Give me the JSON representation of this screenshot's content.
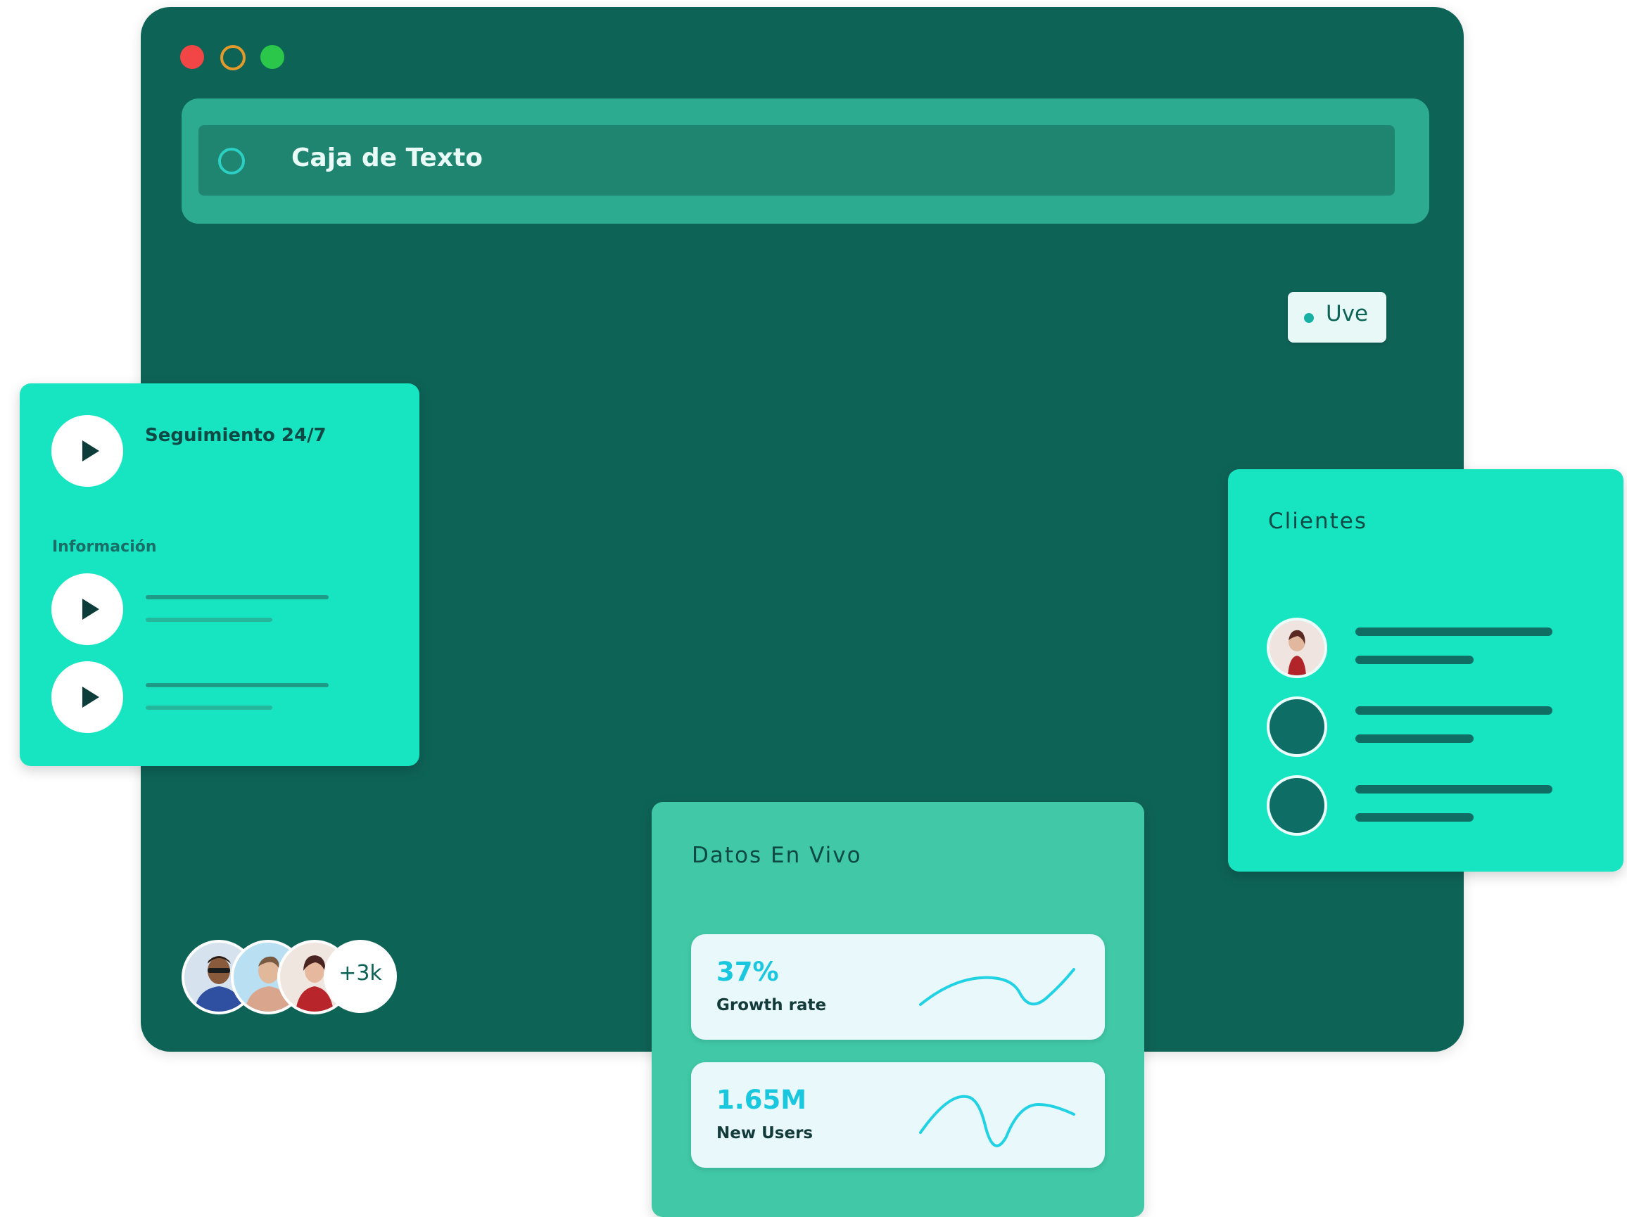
{
  "window": {
    "controls": [
      "close",
      "minimize",
      "maximize"
    ]
  },
  "search": {
    "placeholder": "Caja de Texto",
    "icon": "search-icon"
  },
  "live_badge": {
    "label": "Uve"
  },
  "tracking_card": {
    "title": "Seguimiento 24/7",
    "subtitle": "Información",
    "items": [
      "play-icon",
      "play-icon",
      "play-icon"
    ]
  },
  "clients_card": {
    "title": "Clientes",
    "rows": 3
  },
  "live_data_card": {
    "title": "Datos En Vivo",
    "stats": [
      {
        "value": "37%",
        "label": "Growth rate"
      },
      {
        "value": "1.65M",
        "label": "New Users"
      }
    ]
  },
  "users_group": {
    "count": "+3k"
  },
  "colors": {
    "window_bg": "#0e6357",
    "accent": "#17e5c2",
    "stat_value": "#19c8df",
    "sparkline": "#20d2e3"
  }
}
